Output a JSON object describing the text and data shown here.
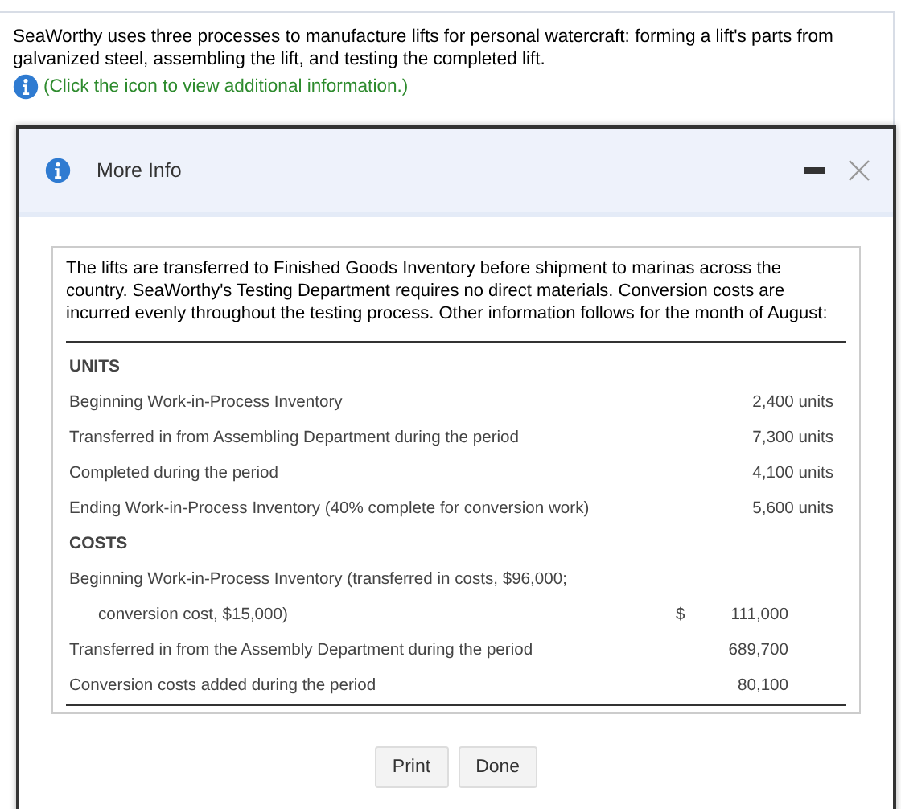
{
  "intro": {
    "text": "SeaWorthy uses three processes to manufacture lifts for personal watercraft: forming a lift's parts from galvanized steel, assembling the lift, and testing the completed lift.",
    "hint": "(Click the icon to view additional information.)"
  },
  "dialog": {
    "title": "More Info",
    "description": "The lifts are transferred to Finished Goods Inventory before shipment to marinas across the country. SeaWorthy's Testing Department requires no direct materials. Conversion costs are incurred evenly throughout the testing process. Other information follows for the month of August:",
    "rows": [
      {
        "kind": "heading",
        "label": "UNITS"
      },
      {
        "kind": "units",
        "label": "Beginning Work-in-Process Inventory",
        "value": "2,400 units"
      },
      {
        "kind": "units",
        "label": "Transferred in from Assembling Department during the period",
        "value": "7,300 units"
      },
      {
        "kind": "units",
        "label": "Completed during the period",
        "value": "4,100 units"
      },
      {
        "kind": "units",
        "label": "Ending Work-in-Process Inventory (40% complete for conversion work)",
        "value": "5,600 units"
      },
      {
        "kind": "heading",
        "label": "COSTS"
      },
      {
        "kind": "label",
        "label": "Beginning Work-in-Process Inventory (transferred in costs, $96,000;"
      },
      {
        "kind": "cost",
        "label": "conversion cost, $15,000)",
        "indent": true,
        "currency": "$",
        "value": "111,000"
      },
      {
        "kind": "cost",
        "label": "Transferred in from the Assembly Department during the period",
        "value": "689,700"
      },
      {
        "kind": "cost",
        "label": "Conversion costs added during the period",
        "value": "80,100"
      }
    ],
    "buttons": [
      "Print",
      "Done"
    ]
  }
}
